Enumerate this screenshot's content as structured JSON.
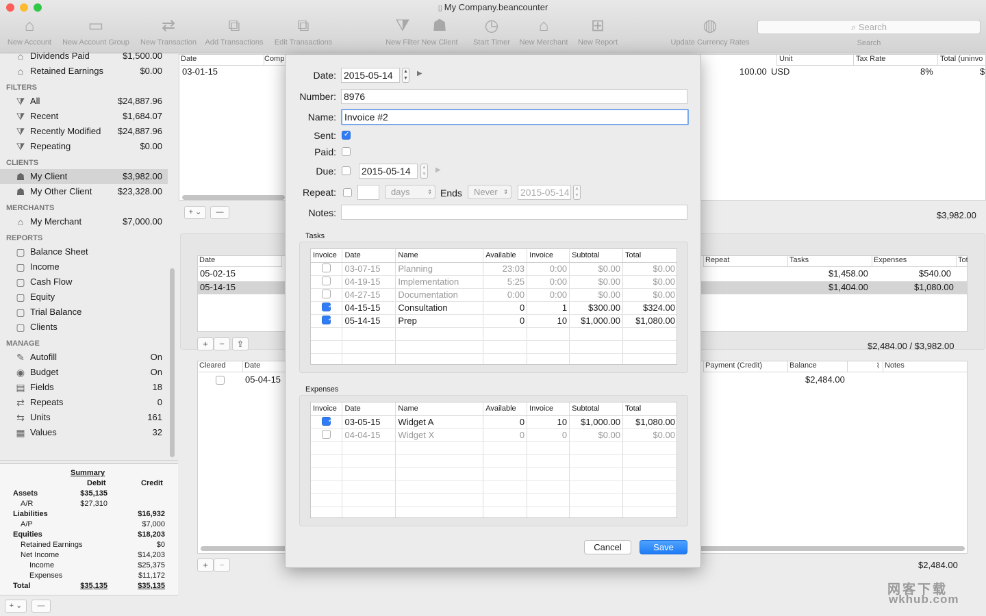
{
  "window": {
    "title": "My Company.beancounter"
  },
  "toolbar": {
    "items": [
      {
        "label": "New Account",
        "icon": "house-plus-icon"
      },
      {
        "label": "New Account Group",
        "icon": "folder-plus-icon"
      },
      {
        "label": "New Transaction",
        "icon": "arrows-plus-icon"
      },
      {
        "label": "Add Transactions",
        "icon": "add-transactions-icon"
      },
      {
        "label": "Edit Transactions",
        "icon": "edit-transactions-icon"
      },
      {
        "label": "New Filter",
        "icon": "filter-plus-icon"
      },
      {
        "label": "New Client",
        "icon": "person-plus-icon"
      },
      {
        "label": "Start Timer",
        "icon": "stopwatch-icon"
      },
      {
        "label": "New Merchant",
        "icon": "store-plus-icon"
      },
      {
        "label": "New Report",
        "icon": "report-plus-icon"
      },
      {
        "label": "Update Currency Rates",
        "icon": "globe-refresh-icon"
      }
    ],
    "search_placeholder": "Search",
    "search_label": "Search"
  },
  "sidebar": {
    "top_items": [
      {
        "label": "Dividends Paid",
        "value": "$1,500.00"
      },
      {
        "label": "Retained Earnings",
        "value": "$0.00"
      }
    ],
    "filters": {
      "title": "FILTERS",
      "items": [
        {
          "label": "All",
          "value": "$24,887.96"
        },
        {
          "label": "Recent",
          "value": "$1,684.07"
        },
        {
          "label": "Recently Modified",
          "value": "$24,887.96"
        },
        {
          "label": "Repeating",
          "value": "$0.00"
        }
      ]
    },
    "clients": {
      "title": "CLIENTS",
      "items": [
        {
          "label": "My Client",
          "value": "$3,982.00"
        },
        {
          "label": "My Other Client",
          "value": "$23,328.00"
        }
      ]
    },
    "merchants": {
      "title": "MERCHANTS",
      "items": [
        {
          "label": "My Merchant",
          "value": "$7,000.00"
        }
      ]
    },
    "reports": {
      "title": "REPORTS",
      "items": [
        {
          "label": "Balance Sheet"
        },
        {
          "label": "Income"
        },
        {
          "label": "Cash Flow"
        },
        {
          "label": "Equity"
        },
        {
          "label": "Trial Balance"
        },
        {
          "label": "Clients"
        }
      ]
    },
    "manage": {
      "title": "MANAGE",
      "items": [
        {
          "label": "Autofill",
          "value": "On"
        },
        {
          "label": "Budget",
          "value": "On"
        },
        {
          "label": "Fields",
          "value": "18"
        },
        {
          "label": "Repeats",
          "value": "0"
        },
        {
          "label": "Units",
          "value": "161"
        },
        {
          "label": "Values",
          "value": "32"
        }
      ]
    }
  },
  "summary": {
    "title": "Summary",
    "debit": "Debit",
    "credit": "Credit",
    "rows": [
      {
        "label": "Assets",
        "debit": "$35,135",
        "credit": "",
        "bold": true,
        "indent": 0
      },
      {
        "label": "A/R",
        "debit": "$27,310",
        "credit": "",
        "bold": false,
        "indent": 1
      },
      {
        "label": "Liabilities",
        "debit": "",
        "credit": "$16,932",
        "bold": true,
        "indent": 0
      },
      {
        "label": "A/P",
        "debit": "",
        "credit": "$7,000",
        "bold": false,
        "indent": 1
      },
      {
        "label": "Equities",
        "debit": "",
        "credit": "$18,203",
        "bold": true,
        "indent": 0
      },
      {
        "label": "Retained Earnings",
        "debit": "",
        "credit": "$0",
        "bold": false,
        "indent": 1
      },
      {
        "label": "Net Income",
        "debit": "",
        "credit": "$14,203",
        "bold": false,
        "indent": 1
      },
      {
        "label": "Income",
        "debit": "",
        "credit": "$25,375",
        "bold": false,
        "indent": 2
      },
      {
        "label": "Expenses",
        "debit": "",
        "credit": "$11,172",
        "bold": false,
        "indent": 2
      },
      {
        "label": "Total",
        "debit": "$35,135",
        "credit": "$35,135",
        "bold": true,
        "indent": 0
      }
    ]
  },
  "background": {
    "top_table": {
      "h_date": "Date",
      "h_comp": "Comp",
      "row_date": "03-01-15",
      "h_unit": "Unit",
      "h_tax": "Tax Rate",
      "h_total": "Total (uninvo",
      "qty": "100.00",
      "unit": "USD",
      "tax": "8%",
      "dollar": "$",
      "total": "$3,982.00"
    },
    "mid_table": {
      "h_date": "Date",
      "h_repeat": "Repeat",
      "h_tasks": "Tasks",
      "h_expenses": "Expenses",
      "h_tot": "Tot",
      "rows": [
        {
          "date": "05-02-15",
          "tasks": "$1,458.00",
          "expenses": "$540.00"
        },
        {
          "date": "05-14-15",
          "tasks": "$1,404.00",
          "expenses": "$1,080.00"
        }
      ],
      "total": "$2,484.00 / $3,982.00"
    },
    "bottom_table": {
      "h_cleared": "Cleared",
      "h_date": "Date",
      "h_payment": "Payment (Credit)",
      "h_balance": "Balance",
      "h_notes": "Notes",
      "row_date": "05-04-15",
      "row_balance": "$2,484.00",
      "total": "$2,484.00"
    }
  },
  "sheet": {
    "date_label": "Date:",
    "date": "2015-05-14",
    "number_label": "Number:",
    "number": "8976",
    "name_label": "Name:",
    "name": "Invoice #2",
    "sent_label": "Sent:",
    "sent": true,
    "paid_label": "Paid:",
    "paid": false,
    "due_label": "Due:",
    "due": "2015-05-14",
    "repeat_label": "Repeat:",
    "repeat_unit": "days",
    "ends_label": "Ends",
    "ends_value": "Never",
    "ends_date": "2015-05-14",
    "notes_label": "Notes:",
    "notes": "",
    "tasks": {
      "title": "Tasks",
      "columns": [
        "Invoice",
        "Date",
        "Name",
        "Available",
        "Invoice",
        "Subtotal",
        "Total"
      ],
      "rows": [
        {
          "checked": false,
          "date": "03-07-15",
          "name": "Planning",
          "available": "23:03",
          "invoice": "0:00",
          "subtotal": "$0.00",
          "total": "$0.00"
        },
        {
          "checked": false,
          "date": "04-19-15",
          "name": "Implementation",
          "available": "5:25",
          "invoice": "0:00",
          "subtotal": "$0.00",
          "total": "$0.00"
        },
        {
          "checked": false,
          "date": "04-27-15",
          "name": "Documentation",
          "available": "0:00",
          "invoice": "0:00",
          "subtotal": "$0.00",
          "total": "$0.00"
        },
        {
          "checked": true,
          "date": "04-15-15",
          "name": "Consultation",
          "available": "0",
          "invoice": "1",
          "subtotal": "$300.00",
          "total": "$324.00"
        },
        {
          "checked": true,
          "date": "05-14-15",
          "name": "Prep",
          "available": "0",
          "invoice": "10",
          "subtotal": "$1,000.00",
          "total": "$1,080.00"
        }
      ]
    },
    "expenses": {
      "title": "Expenses",
      "columns": [
        "Invoice",
        "Date",
        "Name",
        "Available",
        "Invoice",
        "Subtotal",
        "Total"
      ],
      "rows": [
        {
          "checked": true,
          "date": "03-05-15",
          "name": "Widget A",
          "available": "0",
          "invoice": "10",
          "subtotal": "$1,000.00",
          "total": "$1,080.00"
        },
        {
          "checked": false,
          "date": "04-04-15",
          "name": "Widget X",
          "available": "0",
          "invoice": "0",
          "subtotal": "$0.00",
          "total": "$0.00"
        }
      ]
    },
    "cancel": "Cancel",
    "save": "Save"
  },
  "watermark": {
    "line1": "网客下载",
    "line2": "wkhub.com"
  },
  "colors": {
    "accent": "#2f7cf6",
    "selection": "#d4d4d4"
  }
}
